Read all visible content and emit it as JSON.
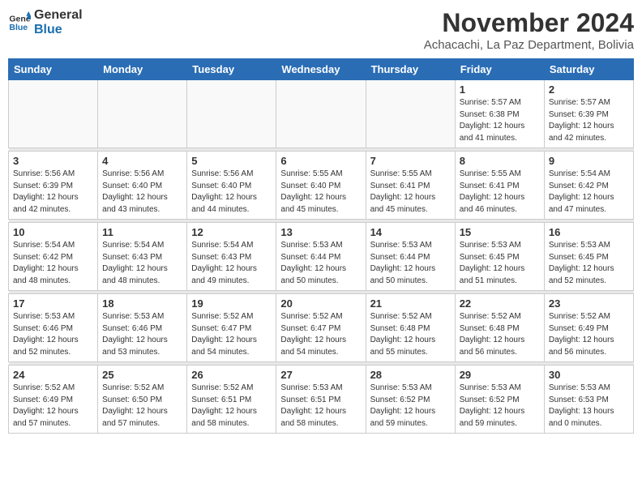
{
  "logo": {
    "line1": "General",
    "line2": "Blue"
  },
  "title": "November 2024",
  "location": "Achacachi, La Paz Department, Bolivia",
  "days_of_week": [
    "Sunday",
    "Monday",
    "Tuesday",
    "Wednesday",
    "Thursday",
    "Friday",
    "Saturday"
  ],
  "weeks": [
    [
      {
        "day": "",
        "info": ""
      },
      {
        "day": "",
        "info": ""
      },
      {
        "day": "",
        "info": ""
      },
      {
        "day": "",
        "info": ""
      },
      {
        "day": "",
        "info": ""
      },
      {
        "day": "1",
        "info": "Sunrise: 5:57 AM\nSunset: 6:38 PM\nDaylight: 12 hours\nand 41 minutes."
      },
      {
        "day": "2",
        "info": "Sunrise: 5:57 AM\nSunset: 6:39 PM\nDaylight: 12 hours\nand 42 minutes."
      }
    ],
    [
      {
        "day": "3",
        "info": "Sunrise: 5:56 AM\nSunset: 6:39 PM\nDaylight: 12 hours\nand 42 minutes."
      },
      {
        "day": "4",
        "info": "Sunrise: 5:56 AM\nSunset: 6:40 PM\nDaylight: 12 hours\nand 43 minutes."
      },
      {
        "day": "5",
        "info": "Sunrise: 5:56 AM\nSunset: 6:40 PM\nDaylight: 12 hours\nand 44 minutes."
      },
      {
        "day": "6",
        "info": "Sunrise: 5:55 AM\nSunset: 6:40 PM\nDaylight: 12 hours\nand 45 minutes."
      },
      {
        "day": "7",
        "info": "Sunrise: 5:55 AM\nSunset: 6:41 PM\nDaylight: 12 hours\nand 45 minutes."
      },
      {
        "day": "8",
        "info": "Sunrise: 5:55 AM\nSunset: 6:41 PM\nDaylight: 12 hours\nand 46 minutes."
      },
      {
        "day": "9",
        "info": "Sunrise: 5:54 AM\nSunset: 6:42 PM\nDaylight: 12 hours\nand 47 minutes."
      }
    ],
    [
      {
        "day": "10",
        "info": "Sunrise: 5:54 AM\nSunset: 6:42 PM\nDaylight: 12 hours\nand 48 minutes."
      },
      {
        "day": "11",
        "info": "Sunrise: 5:54 AM\nSunset: 6:43 PM\nDaylight: 12 hours\nand 48 minutes."
      },
      {
        "day": "12",
        "info": "Sunrise: 5:54 AM\nSunset: 6:43 PM\nDaylight: 12 hours\nand 49 minutes."
      },
      {
        "day": "13",
        "info": "Sunrise: 5:53 AM\nSunset: 6:44 PM\nDaylight: 12 hours\nand 50 minutes."
      },
      {
        "day": "14",
        "info": "Sunrise: 5:53 AM\nSunset: 6:44 PM\nDaylight: 12 hours\nand 50 minutes."
      },
      {
        "day": "15",
        "info": "Sunrise: 5:53 AM\nSunset: 6:45 PM\nDaylight: 12 hours\nand 51 minutes."
      },
      {
        "day": "16",
        "info": "Sunrise: 5:53 AM\nSunset: 6:45 PM\nDaylight: 12 hours\nand 52 minutes."
      }
    ],
    [
      {
        "day": "17",
        "info": "Sunrise: 5:53 AM\nSunset: 6:46 PM\nDaylight: 12 hours\nand 52 minutes."
      },
      {
        "day": "18",
        "info": "Sunrise: 5:53 AM\nSunset: 6:46 PM\nDaylight: 12 hours\nand 53 minutes."
      },
      {
        "day": "19",
        "info": "Sunrise: 5:52 AM\nSunset: 6:47 PM\nDaylight: 12 hours\nand 54 minutes."
      },
      {
        "day": "20",
        "info": "Sunrise: 5:52 AM\nSunset: 6:47 PM\nDaylight: 12 hours\nand 54 minutes."
      },
      {
        "day": "21",
        "info": "Sunrise: 5:52 AM\nSunset: 6:48 PM\nDaylight: 12 hours\nand 55 minutes."
      },
      {
        "day": "22",
        "info": "Sunrise: 5:52 AM\nSunset: 6:48 PM\nDaylight: 12 hours\nand 56 minutes."
      },
      {
        "day": "23",
        "info": "Sunrise: 5:52 AM\nSunset: 6:49 PM\nDaylight: 12 hours\nand 56 minutes."
      }
    ],
    [
      {
        "day": "24",
        "info": "Sunrise: 5:52 AM\nSunset: 6:49 PM\nDaylight: 12 hours\nand 57 minutes."
      },
      {
        "day": "25",
        "info": "Sunrise: 5:52 AM\nSunset: 6:50 PM\nDaylight: 12 hours\nand 57 minutes."
      },
      {
        "day": "26",
        "info": "Sunrise: 5:52 AM\nSunset: 6:51 PM\nDaylight: 12 hours\nand 58 minutes."
      },
      {
        "day": "27",
        "info": "Sunrise: 5:53 AM\nSunset: 6:51 PM\nDaylight: 12 hours\nand 58 minutes."
      },
      {
        "day": "28",
        "info": "Sunrise: 5:53 AM\nSunset: 6:52 PM\nDaylight: 12 hours\nand 59 minutes."
      },
      {
        "day": "29",
        "info": "Sunrise: 5:53 AM\nSunset: 6:52 PM\nDaylight: 12 hours\nand 59 minutes."
      },
      {
        "day": "30",
        "info": "Sunrise: 5:53 AM\nSunset: 6:53 PM\nDaylight: 13 hours\nand 0 minutes."
      }
    ]
  ]
}
